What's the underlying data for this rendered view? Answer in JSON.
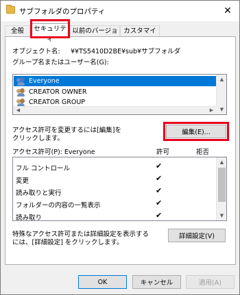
{
  "window": {
    "title": "サブフォルダのプロパティ",
    "close_symbol": "✕"
  },
  "tabs": [
    {
      "label": "全般"
    },
    {
      "label": "セキュリティ"
    },
    {
      "label": "以前のバージョン"
    },
    {
      "label": "カスタマイズ"
    }
  ],
  "object_name": {
    "label": "オブジェクト名:",
    "value": "¥¥TS5410D2BE¥sub¥サブフォルダ"
  },
  "groups_label": "グループ名またはユーザー名(G):",
  "users": [
    {
      "name": "Everyone",
      "selected": true
    },
    {
      "name": "CREATOR OWNER",
      "selected": false
    },
    {
      "name": "CREATOR GROUP",
      "selected": false
    }
  ],
  "change_hint": {
    "line1": "アクセス許可を変更するには[編集]を",
    "line2": "クリックします。"
  },
  "edit_button": "編集(E)...",
  "permissions_header": {
    "label": "アクセス許可(P): Everyone",
    "allow": "許可",
    "deny": "拒否"
  },
  "permissions": [
    {
      "name": "フル コントロール",
      "allow": "✔",
      "deny": ""
    },
    {
      "name": "変更",
      "allow": "✔",
      "deny": ""
    },
    {
      "name": "読み取りと実行",
      "allow": "✔",
      "deny": ""
    },
    {
      "name": "フォルダーの内容の一覧表示",
      "allow": "✔",
      "deny": ""
    },
    {
      "name": "読み取り",
      "allow": "✔",
      "deny": ""
    }
  ],
  "advanced_hint": {
    "line1": "特殊なアクセス許可または詳細設定を表示する",
    "line2": "には、[詳細設定] をクリックします。"
  },
  "advanced_button": "詳細設定(V)",
  "footer": {
    "ok": "OK",
    "cancel": "キャンセル",
    "apply": "適用(A)"
  },
  "colors": {
    "highlight": "#e8001c",
    "selection": "#0078d7"
  }
}
